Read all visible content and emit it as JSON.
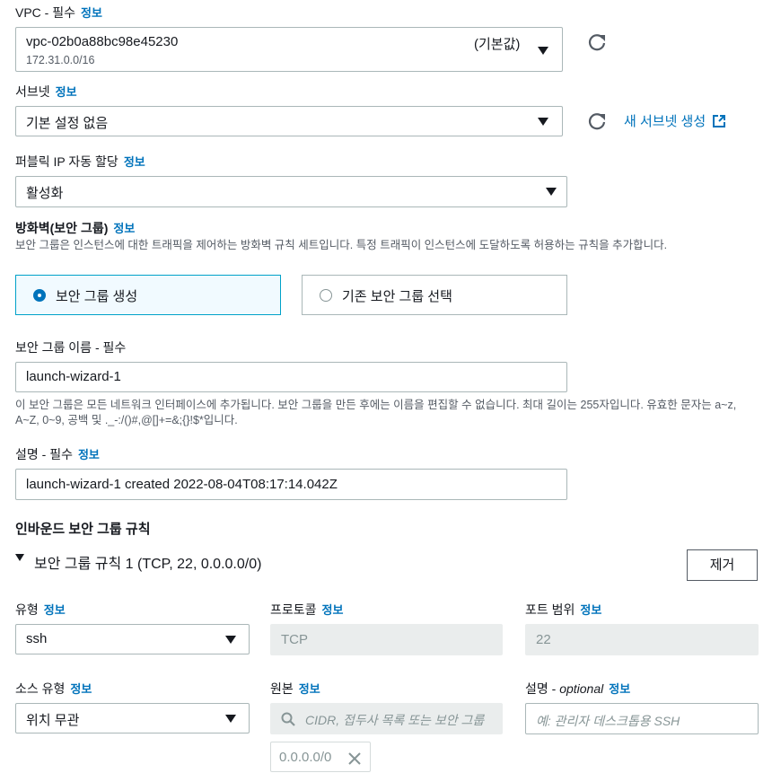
{
  "vpc": {
    "label": "VPC - 필수",
    "info": "정보",
    "value": "vpc-02b0a88bc98e45230",
    "cidr": "172.31.0.0/16",
    "default_tag": "(기본값)"
  },
  "subnet": {
    "label": "서브넷",
    "info": "정보",
    "value": "기본 설정 없음",
    "create_link": "새 서브넷 생성"
  },
  "public_ip": {
    "label": "퍼블릭 IP 자동 할당",
    "info": "정보",
    "value": "활성화"
  },
  "firewall": {
    "title": "방화벽(보안 그룹)",
    "info": "정보",
    "description": "보안 그룹은 인스턴스에 대한 트래픽을 제어하는 방화벽 규칙 세트입니다. 특정 트래픽이 인스턴스에 도달하도록 허용하는 규칙을 추가합니다.",
    "option_create": "보안 그룹 생성",
    "option_existing": "기존 보안 그룹 선택"
  },
  "sg_name": {
    "label": "보안 그룹 이름 - 필수",
    "value": "launch-wizard-1",
    "help": "이 보안 그룹은 모든 네트워크 인터페이스에 추가됩니다. 보안 그룹을 만든 후에는 이름을 편집할 수 없습니다. 최대 길이는 255자입니다. 유효한 문자는 a~z, A~Z, 0~9, 공백 및 ._-:/()#,@[]+=&;{}!$*입니다."
  },
  "sg_desc": {
    "label": "설명 - 필수",
    "info": "정보",
    "value": "launch-wizard-1 created 2022-08-04T08:17:14.042Z"
  },
  "inbound": {
    "title": "인바운드 보안 그룹 규칙",
    "rule_title": "보안 그룹 규칙 1 (TCP, 22, 0.0.0.0/0)",
    "remove_button": "제거",
    "type_label": "유형",
    "protocol_label": "프로토콜",
    "port_label": "포트 범위",
    "info": "정보",
    "type_value": "ssh",
    "protocol_value": "TCP",
    "port_value": "22",
    "source_type_label": "소스 유형",
    "source_label": "원본",
    "desc_label": "설명 - ",
    "desc_optional": "optional",
    "source_type_value": "위치 무관",
    "source_placeholder": "CIDR, 접두사 목록 또는 보안 그룹",
    "desc_placeholder": "예: 관리자 데스크톱용 SSH",
    "source_token": "0.0.0.0/0"
  },
  "colors": {
    "link": "#0073bb",
    "selected_border": "#00a1c9",
    "selected_bg": "#f1faff"
  }
}
